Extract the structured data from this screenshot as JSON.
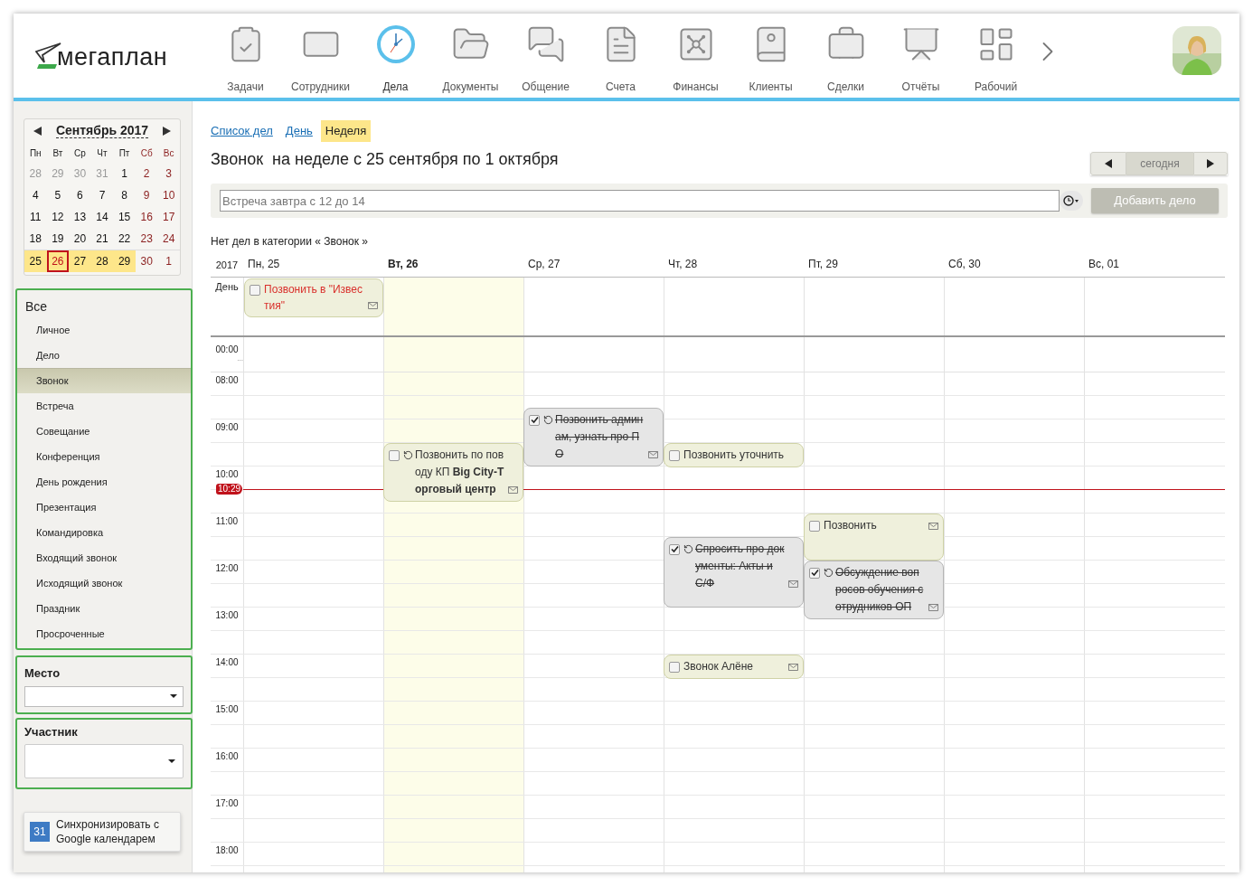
{
  "header": {
    "logo": "мегаплан",
    "nav": [
      {
        "label": "Задачи",
        "selected": false
      },
      {
        "label": "Сотрудники",
        "selected": false
      },
      {
        "label": "Дела",
        "selected": true
      },
      {
        "label": "Документы",
        "selected": false
      },
      {
        "label": "Общение",
        "selected": false
      },
      {
        "label": "Счета",
        "selected": false
      },
      {
        "label": "Финансы",
        "selected": false
      },
      {
        "label": "Клиенты",
        "selected": false
      },
      {
        "label": "Сделки",
        "selected": false
      },
      {
        "label": "Отчёты",
        "selected": false
      },
      {
        "label": "Рабочий",
        "selected": false
      }
    ]
  },
  "sidebar": {
    "mini_calendar": {
      "title": "Сентябрь 2017",
      "weekdays": [
        "Пн",
        "Вт",
        "Ср",
        "Чт",
        "Пт",
        "Сб",
        "Вс"
      ],
      "weeks": [
        [
          {
            "label": "28",
            "muted": true,
            "selected": false,
            "today": false
          },
          {
            "label": "29",
            "muted": true,
            "selected": false,
            "today": false
          },
          {
            "label": "30",
            "muted": true,
            "selected": false,
            "today": false
          },
          {
            "label": "31",
            "muted": true,
            "selected": false,
            "today": false
          },
          {
            "label": "1",
            "muted": false,
            "selected": false,
            "today": false
          },
          {
            "label": "2",
            "muted": false,
            "selected": false,
            "today": false
          },
          {
            "label": "3",
            "muted": false,
            "selected": false,
            "today": false
          }
        ],
        [
          {
            "label": "4",
            "muted": false,
            "selected": false,
            "today": false
          },
          {
            "label": "5",
            "muted": false,
            "selected": false,
            "today": false
          },
          {
            "label": "6",
            "muted": false,
            "selected": false,
            "today": false
          },
          {
            "label": "7",
            "muted": false,
            "selected": false,
            "today": false
          },
          {
            "label": "8",
            "muted": false,
            "selected": false,
            "today": false
          },
          {
            "label": "9",
            "muted": false,
            "selected": false,
            "today": false
          },
          {
            "label": "10",
            "muted": false,
            "selected": false,
            "today": false
          }
        ],
        [
          {
            "label": "11",
            "muted": false,
            "selected": false,
            "today": false
          },
          {
            "label": "12",
            "muted": false,
            "selected": false,
            "today": false
          },
          {
            "label": "13",
            "muted": false,
            "selected": false,
            "today": false
          },
          {
            "label": "14",
            "muted": false,
            "selected": false,
            "today": false
          },
          {
            "label": "15",
            "muted": false,
            "selected": false,
            "today": false
          },
          {
            "label": "16",
            "muted": false,
            "selected": false,
            "today": false
          },
          {
            "label": "17",
            "muted": false,
            "selected": false,
            "today": false
          }
        ],
        [
          {
            "label": "18",
            "muted": false,
            "selected": false,
            "today": false
          },
          {
            "label": "19",
            "muted": false,
            "selected": false,
            "today": false
          },
          {
            "label": "20",
            "muted": false,
            "selected": false,
            "today": false
          },
          {
            "label": "21",
            "muted": false,
            "selected": false,
            "today": false
          },
          {
            "label": "22",
            "muted": false,
            "selected": false,
            "today": false
          },
          {
            "label": "23",
            "muted": false,
            "selected": false,
            "today": false
          },
          {
            "label": "24",
            "muted": false,
            "selected": false,
            "today": false
          }
        ],
        [
          {
            "label": "25",
            "muted": false,
            "selected": true,
            "today": false
          },
          {
            "label": "26",
            "muted": false,
            "selected": true,
            "today": true
          },
          {
            "label": "27",
            "muted": false,
            "selected": true,
            "today": false
          },
          {
            "label": "28",
            "muted": false,
            "selected": true,
            "today": false
          },
          {
            "label": "29",
            "muted": false,
            "selected": true,
            "today": false
          },
          {
            "label": "30",
            "muted": false,
            "selected": false,
            "today": false
          },
          {
            "label": "1",
            "muted": false,
            "selected": false,
            "today": false
          }
        ]
      ]
    },
    "categories": {
      "all": "Все",
      "items": [
        {
          "label": "Личное",
          "selected": false
        },
        {
          "label": "Дело",
          "selected": false
        },
        {
          "label": "Звонок",
          "selected": true
        },
        {
          "label": "Встреча",
          "selected": false
        },
        {
          "label": "Совещание",
          "selected": false
        },
        {
          "label": "Конференция",
          "selected": false
        },
        {
          "label": "День рождения",
          "selected": false
        },
        {
          "label": "Презентация",
          "selected": false
        },
        {
          "label": "Командировка",
          "selected": false
        },
        {
          "label": "Входящий звонок",
          "selected": false
        },
        {
          "label": "Исходящий звонок",
          "selected": false
        },
        {
          "label": "Праздник",
          "selected": false
        },
        {
          "label": "Просроченные",
          "selected": false
        }
      ]
    },
    "place": {
      "label": "Место"
    },
    "participant": {
      "label": "Участник"
    },
    "sync": {
      "icon_text": "31",
      "label": "Синхронизировать с Google календарем"
    }
  },
  "main": {
    "views": [
      {
        "label": "Список дел",
        "selected": false
      },
      {
        "label": "День",
        "selected": false
      },
      {
        "label": "Неделя",
        "selected": true
      }
    ],
    "title": "Звонок  на неделе с 25 сентября по 1 октября",
    "today_button": "сегодня",
    "quick_add": {
      "placeholder": "Встреча завтра с 12 до 14",
      "button": "Добавить дело",
      "disabled": true
    },
    "notice": "Нет дел в категории « Звонок »",
    "week": {
      "year": "2017",
      "all_day_label": "День",
      "first_hour": "00:00",
      "gap": "...",
      "hours": [
        "08:00",
        "09:00",
        "10:00",
        "11:00",
        "12:00",
        "13:00",
        "14:00",
        "15:00",
        "16:00",
        "17:00",
        "18:00"
      ],
      "now": "10:29",
      "days": [
        {
          "label": "Пн, 25",
          "today": false,
          "all_day": [
            {
              "text": "Позвонить в \"Известия\"",
              "done": false,
              "overdue": true,
              "recurring": false,
              "mail": true
            }
          ]
        },
        {
          "label": "Вт, 26",
          "today": true,
          "events": [
            {
              "text": "Позвонить по поводу КП  **Big City-Торговый центр**",
              "done": false,
              "overdue": false,
              "recurring": true,
              "mail": true
            }
          ]
        },
        {
          "label": "Ср, 27",
          "today": false,
          "events": [
            {
              "text": "Позвонить админам, узнать про ПО",
              "done": true,
              "overdue": false,
              "recurring": true,
              "mail": true
            }
          ]
        },
        {
          "label": "Чт, 28",
          "today": false,
          "events": [
            {
              "text": "Позвонить уточнить",
              "done": false,
              "overdue": false,
              "recurring": false,
              "mail": false
            },
            {
              "text": "Спросить про документы: Акты и С/Ф",
              "done": true,
              "overdue": false,
              "recurring": true,
              "mail": true
            },
            {
              "text": "Звонок Алёне",
              "done": false,
              "overdue": false,
              "recurring": false,
              "mail": true
            }
          ]
        },
        {
          "label": "Пт, 29",
          "today": false,
          "events": [
            {
              "text": "Позвонить",
              "done": false,
              "overdue": false,
              "recurring": false,
              "mail": true
            },
            {
              "text": "Обсуждение вопросов обучения сотрудников ОП",
              "done": true,
              "overdue": false,
              "recurring": true,
              "mail": true
            }
          ]
        },
        {
          "label": "Сб, 30",
          "today": false
        },
        {
          "label": "Вс, 01",
          "today": false
        }
      ]
    }
  }
}
